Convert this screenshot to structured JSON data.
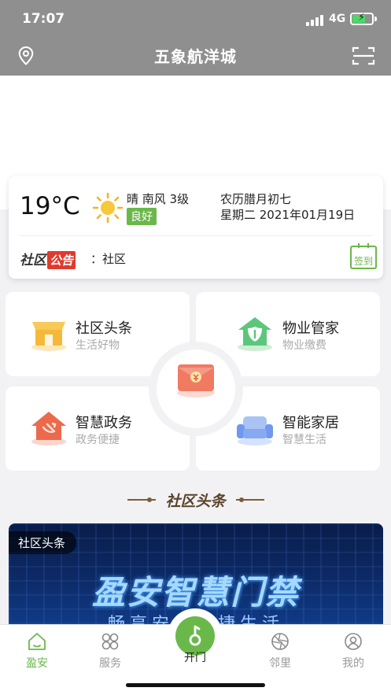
{
  "status_bar": {
    "time": "17:07",
    "network": "4G"
  },
  "header": {
    "title": "五象航洋城"
  },
  "weather": {
    "temperature": "19°C",
    "condition": "晴 南风 3级",
    "aqi": "良好",
    "lunar_date": "农历腊月初七",
    "date": "星期二 2021年01月19日"
  },
  "notice": {
    "logo_part1": "社区",
    "logo_part2": "公告",
    "text": "：社区",
    "sign_label": "签到"
  },
  "tiles": [
    {
      "title": "社区头条",
      "subtitle": "生活好物"
    },
    {
      "title": "物业管家",
      "subtitle": "物业缴费"
    },
    {
      "title": "智慧政务",
      "subtitle": "政务便捷"
    },
    {
      "title": "智能家居",
      "subtitle": "智慧生活"
    }
  ],
  "section": {
    "title": "社区头条"
  },
  "news": {
    "tag": "社区头条",
    "headline": "盈安智慧门禁",
    "subline": "畅享安全便捷生活"
  },
  "tabbar": {
    "items": [
      {
        "label": "盈安"
      },
      {
        "label": "服务"
      },
      {
        "label": "开门"
      },
      {
        "label": "邻里"
      },
      {
        "label": "我的"
      }
    ]
  },
  "colors": {
    "accent": "#6bb84a",
    "header_bg": "#8f8f8f",
    "notice_red": "#e03a2e"
  }
}
